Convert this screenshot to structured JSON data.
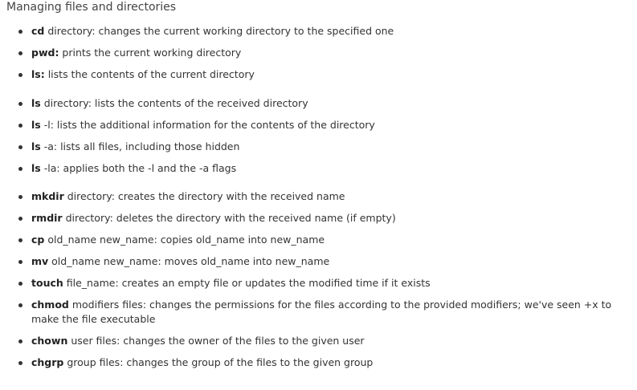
{
  "page": {
    "title": "Managing files and directories"
  },
  "commands": [
    {
      "name": "cd",
      "args": " directory",
      "desc": ": changes the current working directory to the specified one"
    },
    {
      "name": "pwd:",
      "args": "",
      "desc": " prints the current working directory"
    },
    {
      "name": "ls:",
      "args": "",
      "desc": " lists the contents of the current directory"
    },
    {
      "name": "ls",
      "args": " directory",
      "desc": ": lists the contents of the received directory"
    },
    {
      "name": "ls",
      "args": " -l",
      "desc": ": lists the additional information for the contents of the directory"
    },
    {
      "name": "ls",
      "args": " -a",
      "desc": ": lists all files, including those hidden"
    },
    {
      "name": "ls",
      "args": " -la",
      "desc": ": applies both the -l and the -a flags"
    },
    {
      "name": "mkdir",
      "args": " directory",
      "desc": ": creates the directory with the received name"
    },
    {
      "name": "rmdir",
      "args": " directory",
      "desc": ": deletes the directory with the received name (if empty)"
    },
    {
      "name": "cp",
      "args": " old_name new_name",
      "desc": ": copies old_name into new_name"
    },
    {
      "name": "mv",
      "args": " old_name new_name",
      "desc": ": moves old_name into new_name"
    },
    {
      "name": "touch",
      "args": " file_name",
      "desc": ": creates an empty file or updates the modified time if it exists"
    },
    {
      "name": "chmod",
      "args": " modifiers files",
      "desc": ": changes the permissions for the files according to the provided modifiers; we've seen +x to make the file executable"
    },
    {
      "name": "chown",
      "args": " user files",
      "desc": ": changes the owner of the files to the given user"
    },
    {
      "name": "chgrp",
      "args": " group files",
      "desc": ": changes the group of the files to the given group"
    }
  ]
}
